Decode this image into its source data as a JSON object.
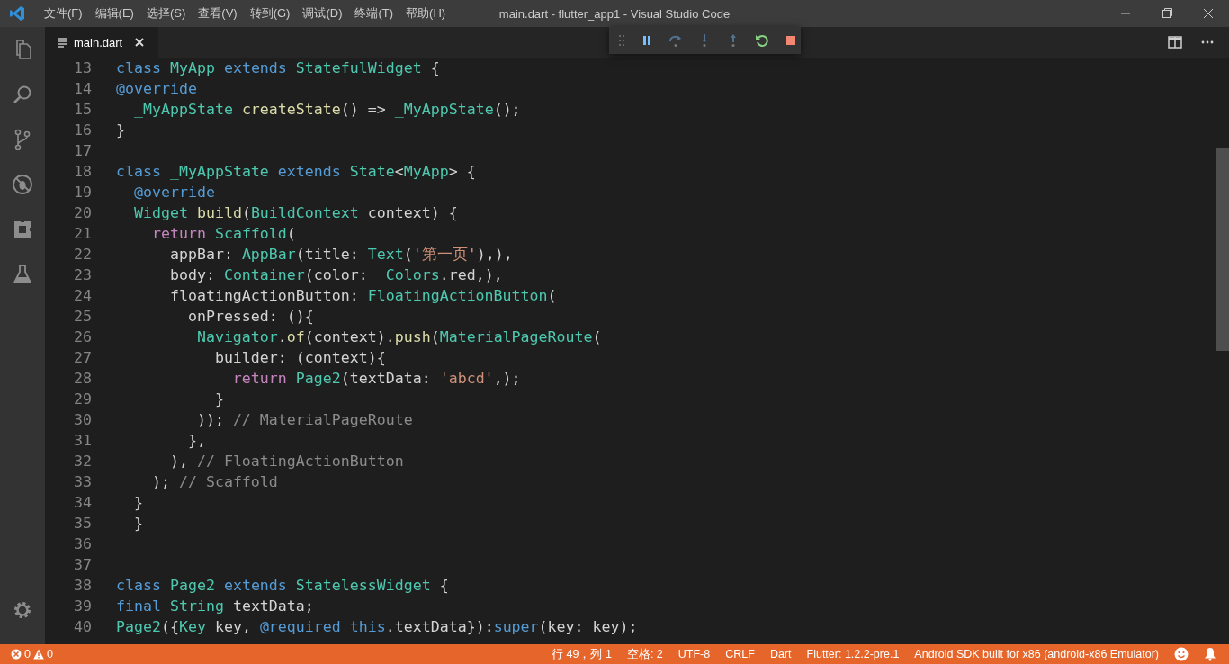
{
  "window": {
    "title": "main.dart - flutter_app1 - Visual Studio Code"
  },
  "menu": [
    "文件(F)",
    "编辑(E)",
    "选择(S)",
    "查看(V)",
    "转到(G)",
    "调试(D)",
    "终端(T)",
    "帮助(H)"
  ],
  "activity_bar": [
    {
      "kind": "files"
    },
    {
      "kind": "search"
    },
    {
      "kind": "source-control"
    },
    {
      "kind": "debug"
    },
    {
      "kind": "extensions"
    },
    {
      "kind": "flask"
    },
    {
      "kind": "settings"
    }
  ],
  "tabs": [
    {
      "label": "main.dart",
      "selected": true
    }
  ],
  "debug_toolbar": [
    {
      "kind": "grip",
      "disabled": false
    },
    {
      "kind": "pause",
      "disabled": false
    },
    {
      "kind": "step-over",
      "disabled": true
    },
    {
      "kind": "step-into",
      "disabled": true
    },
    {
      "kind": "step-out",
      "disabled": true
    },
    {
      "kind": "restart",
      "disabled": false
    },
    {
      "kind": "stop",
      "disabled": false
    }
  ],
  "editor": {
    "lines": [
      {
        "number": "13",
        "tokens": [
          {
            "kind": "keyword",
            "text": "class "
          },
          {
            "kind": "type",
            "text": "MyApp "
          },
          {
            "kind": "keyword",
            "text": "extends "
          },
          {
            "kind": "type",
            "text": "StatefulWidget"
          },
          {
            "kind": "plain",
            "text": " {"
          }
        ]
      },
      {
        "number": "14",
        "tokens": [
          {
            "kind": "keyword",
            "text": "@override"
          }
        ]
      },
      {
        "number": "15",
        "tokens": [
          {
            "kind": "type",
            "text": "  _MyAppState "
          },
          {
            "kind": "function",
            "text": "createState"
          },
          {
            "kind": "plain",
            "text": "() => "
          },
          {
            "kind": "type",
            "text": "_MyAppState"
          },
          {
            "kind": "plain",
            "text": "();"
          }
        ]
      },
      {
        "number": "16",
        "tokens": [
          {
            "kind": "plain",
            "text": "}"
          }
        ]
      },
      {
        "number": "17"
      },
      {
        "number": "18",
        "tokens": [
          {
            "kind": "keyword",
            "text": "class "
          },
          {
            "kind": "type",
            "text": "_MyAppState "
          },
          {
            "kind": "keyword",
            "text": "extends "
          },
          {
            "kind": "type",
            "text": "State"
          },
          {
            "kind": "plain",
            "text": "<"
          },
          {
            "kind": "type",
            "text": "MyApp"
          },
          {
            "kind": "plain",
            "text": "> {"
          }
        ]
      },
      {
        "number": "19",
        "tokens": [
          {
            "kind": "keyword",
            "text": "  @override"
          }
        ]
      },
      {
        "number": "20",
        "tokens": [
          {
            "kind": "type",
            "text": "  Widget "
          },
          {
            "kind": "function",
            "text": "build"
          },
          {
            "kind": "plain",
            "text": "("
          },
          {
            "kind": "type",
            "text": "BuildContext"
          },
          {
            "kind": "plain",
            "text": " context) {"
          }
        ]
      },
      {
        "number": "21",
        "tokens": [
          {
            "kind": "control",
            "text": "    return "
          },
          {
            "kind": "type",
            "text": "Scaffold"
          },
          {
            "kind": "plain",
            "text": "("
          }
        ]
      },
      {
        "number": "22",
        "tokens": [
          {
            "kind": "plain",
            "text": "      appBar: "
          },
          {
            "kind": "type",
            "text": "AppBar"
          },
          {
            "kind": "plain",
            "text": "(title: "
          },
          {
            "kind": "type",
            "text": "Text"
          },
          {
            "kind": "plain",
            "text": "("
          },
          {
            "kind": "string",
            "text": "'第一页'"
          },
          {
            "kind": "plain",
            "text": "),),"
          }
        ]
      },
      {
        "number": "23",
        "tokens": [
          {
            "kind": "plain",
            "text": "      body: "
          },
          {
            "kind": "type",
            "text": "Container"
          },
          {
            "kind": "plain",
            "text": "(color:  "
          },
          {
            "kind": "type",
            "text": "Colors"
          },
          {
            "kind": "plain",
            "text": ".red,),"
          }
        ]
      },
      {
        "number": "24",
        "tokens": [
          {
            "kind": "plain",
            "text": "      floatingActionButton: "
          },
          {
            "kind": "type",
            "text": "FloatingActionButton"
          },
          {
            "kind": "plain",
            "text": "("
          }
        ]
      },
      {
        "number": "25",
        "tokens": [
          {
            "kind": "plain",
            "text": "        onPressed: (){"
          }
        ]
      },
      {
        "number": "26",
        "tokens": [
          {
            "kind": "type",
            "text": "         Navigator"
          },
          {
            "kind": "plain",
            "text": "."
          },
          {
            "kind": "function",
            "text": "of"
          },
          {
            "kind": "plain",
            "text": "(context)."
          },
          {
            "kind": "function",
            "text": "push"
          },
          {
            "kind": "plain",
            "text": "("
          },
          {
            "kind": "type",
            "text": "MaterialPageRoute"
          },
          {
            "kind": "plain",
            "text": "("
          }
        ]
      },
      {
        "number": "27",
        "tokens": [
          {
            "kind": "plain",
            "text": "           builder: (context){"
          }
        ]
      },
      {
        "number": "28",
        "tokens": [
          {
            "kind": "control",
            "text": "             return "
          },
          {
            "kind": "type",
            "text": "Page2"
          },
          {
            "kind": "plain",
            "text": "(textData: "
          },
          {
            "kind": "string",
            "text": "'abcd'"
          },
          {
            "kind": "plain",
            "text": ",);"
          }
        ]
      },
      {
        "number": "29",
        "tokens": [
          {
            "kind": "plain",
            "text": "           }"
          }
        ]
      },
      {
        "number": "30",
        "tokens": [
          {
            "kind": "plain",
            "text": "         )); "
          },
          {
            "kind": "comment",
            "text": "// MaterialPageRoute"
          }
        ]
      },
      {
        "number": "31",
        "tokens": [
          {
            "kind": "plain",
            "text": "        },"
          }
        ]
      },
      {
        "number": "32",
        "tokens": [
          {
            "kind": "plain",
            "text": "      ), "
          },
          {
            "kind": "comment",
            "text": "// FloatingActionButton"
          }
        ]
      },
      {
        "number": "33",
        "tokens": [
          {
            "kind": "plain",
            "text": "    ); "
          },
          {
            "kind": "comment",
            "text": "// Scaffold"
          }
        ]
      },
      {
        "number": "34",
        "tokens": [
          {
            "kind": "plain",
            "text": "  }"
          }
        ]
      },
      {
        "number": "35",
        "tokens": [
          {
            "kind": "plain",
            "text": "  }"
          }
        ]
      },
      {
        "number": "36"
      },
      {
        "number": "37"
      },
      {
        "number": "38",
        "tokens": [
          {
            "kind": "keyword",
            "text": "class "
          },
          {
            "kind": "type",
            "text": "Page2 "
          },
          {
            "kind": "keyword",
            "text": "extends "
          },
          {
            "kind": "type",
            "text": "StatelessWidget"
          },
          {
            "kind": "plain",
            "text": " {"
          }
        ]
      },
      {
        "number": "39",
        "tokens": [
          {
            "kind": "keyword",
            "text": "final "
          },
          {
            "kind": "type",
            "text": "String"
          },
          {
            "kind": "plain",
            "text": " textData;"
          }
        ]
      },
      {
        "number": "40",
        "tokens": [
          {
            "kind": "type",
            "text": "Page2"
          },
          {
            "kind": "plain",
            "text": "({"
          },
          {
            "kind": "type",
            "text": "Key"
          },
          {
            "kind": "plain",
            "text": " key, "
          },
          {
            "kind": "keyword",
            "text": "@required this"
          },
          {
            "kind": "plain",
            "text": ".textData}):"
          },
          {
            "kind": "keyword",
            "text": "super"
          },
          {
            "kind": "plain",
            "text": "(key: key);"
          }
        ]
      }
    ]
  },
  "status_bar": {
    "errors": "0",
    "warnings": "0",
    "items": [
      "行 49，列 1",
      "空格: 2",
      "UTF-8",
      "CRLF",
      "Dart",
      "Flutter: 1.2.2-pre.1",
      "Android SDK built for x86 (android-x86 Emulator)"
    ]
  }
}
